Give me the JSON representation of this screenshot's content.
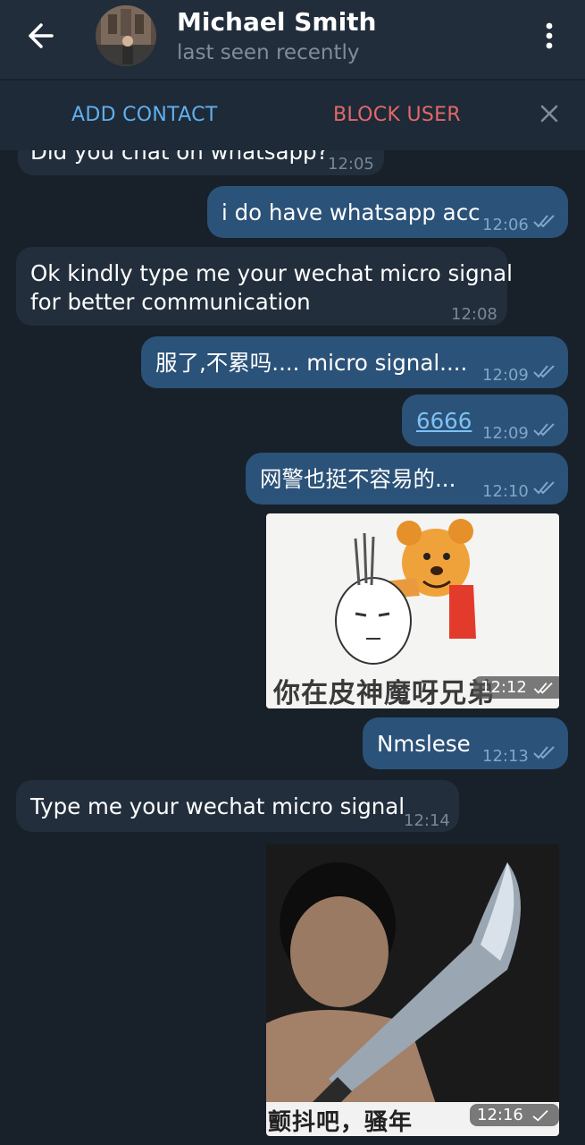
{
  "header": {
    "name": "Michael Smith",
    "status": "last seen recently",
    "back_icon": "arrow-left-icon",
    "menu_icon": "more-vertical-icon"
  },
  "action_bar": {
    "add_contact": "ADD CONTACT",
    "block_user": "BLOCK USER",
    "close_icon": "close-icon"
  },
  "messages": [
    {
      "dir": "in",
      "text": "Did you chat on whatsapp?",
      "time": "12:05"
    },
    {
      "dir": "out",
      "text": "i do have whatsapp acc",
      "time": "12:06",
      "read": true
    },
    {
      "dir": "in",
      "text_lines": [
        "Ok kindly type me your wechat micro signal",
        "for better communication"
      ],
      "time": "12:08"
    },
    {
      "dir": "out",
      "text": "服了,不累吗.... micro signal....",
      "time": "12:09",
      "read": true
    },
    {
      "dir": "out",
      "text": "6666",
      "time": "12:09",
      "read": true,
      "is_link": true
    },
    {
      "dir": "out",
      "text": "网警也挺不容易的...",
      "time": "12:10",
      "read": true
    },
    {
      "dir": "out",
      "type": "sticker",
      "caption": "你在皮神魔呀兄弟",
      "time": "12:12",
      "read": true
    },
    {
      "dir": "out",
      "text": "Nmslese",
      "time": "12:13",
      "read": true
    },
    {
      "dir": "in",
      "text": "Type me your wechat micro signal",
      "time": "12:14"
    },
    {
      "dir": "out",
      "type": "photo",
      "caption": "颤抖吧，骚年",
      "time": "12:16",
      "read": false
    }
  ],
  "colors": {
    "background": "#182029",
    "header": "#212d3b",
    "incoming_bubble": "#222e3c",
    "outgoing_bubble": "#2b5278",
    "accent_blue": "#5fb0ef",
    "danger_red": "#e4686a"
  }
}
